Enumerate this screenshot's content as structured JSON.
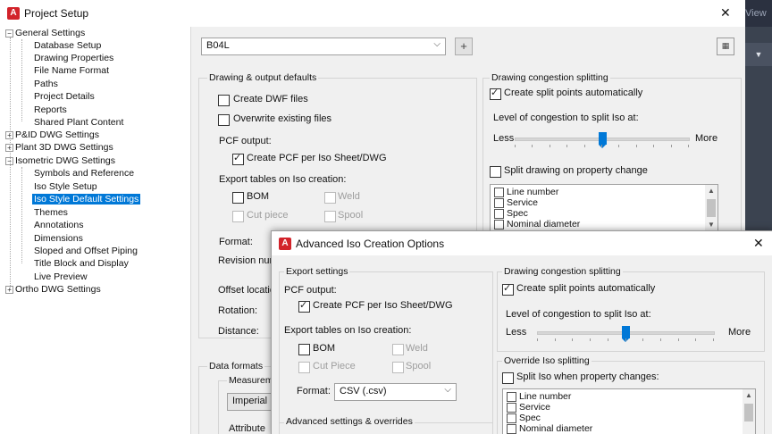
{
  "window": {
    "title": "Project Setup",
    "close_label": "✕",
    "bg_strip_label": "View"
  },
  "tree": {
    "nodes": [
      {
        "label": "General Settings",
        "expander": "−"
      },
      {
        "label": "Database Setup"
      },
      {
        "label": "Drawing Properties"
      },
      {
        "label": "File Name Format"
      },
      {
        "label": "Paths"
      },
      {
        "label": "Project Details"
      },
      {
        "label": "Reports"
      },
      {
        "label": "Shared Plant Content"
      },
      {
        "label": "P&ID DWG Settings",
        "expander": "+"
      },
      {
        "label": "Plant 3D DWG Settings",
        "expander": "+"
      },
      {
        "label": "Isometric DWG Settings",
        "expander": "−"
      },
      {
        "label": "Symbols and Reference"
      },
      {
        "label": "Iso Style Setup"
      },
      {
        "label": "Iso Style Default Settings",
        "selected": true
      },
      {
        "label": "Themes"
      },
      {
        "label": "Annotations"
      },
      {
        "label": "Dimensions"
      },
      {
        "label": "Sloped and Offset Piping"
      },
      {
        "label": "Title Block and Display"
      },
      {
        "label": "Live Preview"
      },
      {
        "label": "Ortho DWG Settings",
        "expander": "+"
      }
    ]
  },
  "style_combo": {
    "value": "B04L",
    "add_label": "+"
  },
  "drawing_output": {
    "group_label": "Drawing & output defaults",
    "create_dwf": "Create DWF files",
    "overwrite": "Overwrite existing files",
    "pcf_output": "PCF output:",
    "create_pcf": "Create PCF per Iso Sheet/DWG",
    "export_tables": "Export tables on Iso creation:",
    "bom": "BOM",
    "weld": "Weld",
    "cut_piece": "Cut piece",
    "spool": "Spool",
    "format": "Format:",
    "revision": "Revision num",
    "offset_location": "Offset locatio",
    "rotation": "Rotation:",
    "distance": "Distance:"
  },
  "congestion": {
    "group_label": "Drawing congestion splitting",
    "create_split": "Create split points automatically",
    "level_label": "Level of congestion to split Iso at:",
    "less": "Less",
    "more": "More",
    "level_fraction": 0.5,
    "split_on_property": "Split drawing on property change",
    "list_items": [
      "Line number",
      "Service",
      "Spec",
      "Nominal diameter"
    ]
  },
  "data_formats": {
    "group_label": "Data formats",
    "measurement": "Measureme",
    "units_value": "Imperial",
    "attribute": "Attribute"
  },
  "dialog": {
    "title": "Advanced Iso Creation Options",
    "close_label": "✕",
    "export_group": "Export settings",
    "pcf_output": "PCF output:",
    "create_pcf": "Create PCF per Iso Sheet/DWG",
    "export_tables": "Export tables on Iso creation:",
    "bom": "BOM",
    "weld": "Weld",
    "cut_piece": "Cut Piece",
    "spool": "Spool",
    "format_label": "Format:",
    "format_value": "CSV (.csv)",
    "advanced_group": "Advanced settings & overrides",
    "congestion_group": "Drawing congestion splitting",
    "create_split": "Create split points automatically",
    "level_label": "Level of congestion to split Iso at:",
    "less": "Less",
    "more": "More",
    "level_fraction": 0.5,
    "override_group": "Override Iso splitting",
    "split_when": "Split Iso when property changes:",
    "list_items": [
      "Line number",
      "Service",
      "Spec",
      "Nominal diameter"
    ]
  },
  "colors": {
    "selection": "#0078d7",
    "app_icon": "#d2232a",
    "dark_strip": "#3b4350"
  }
}
